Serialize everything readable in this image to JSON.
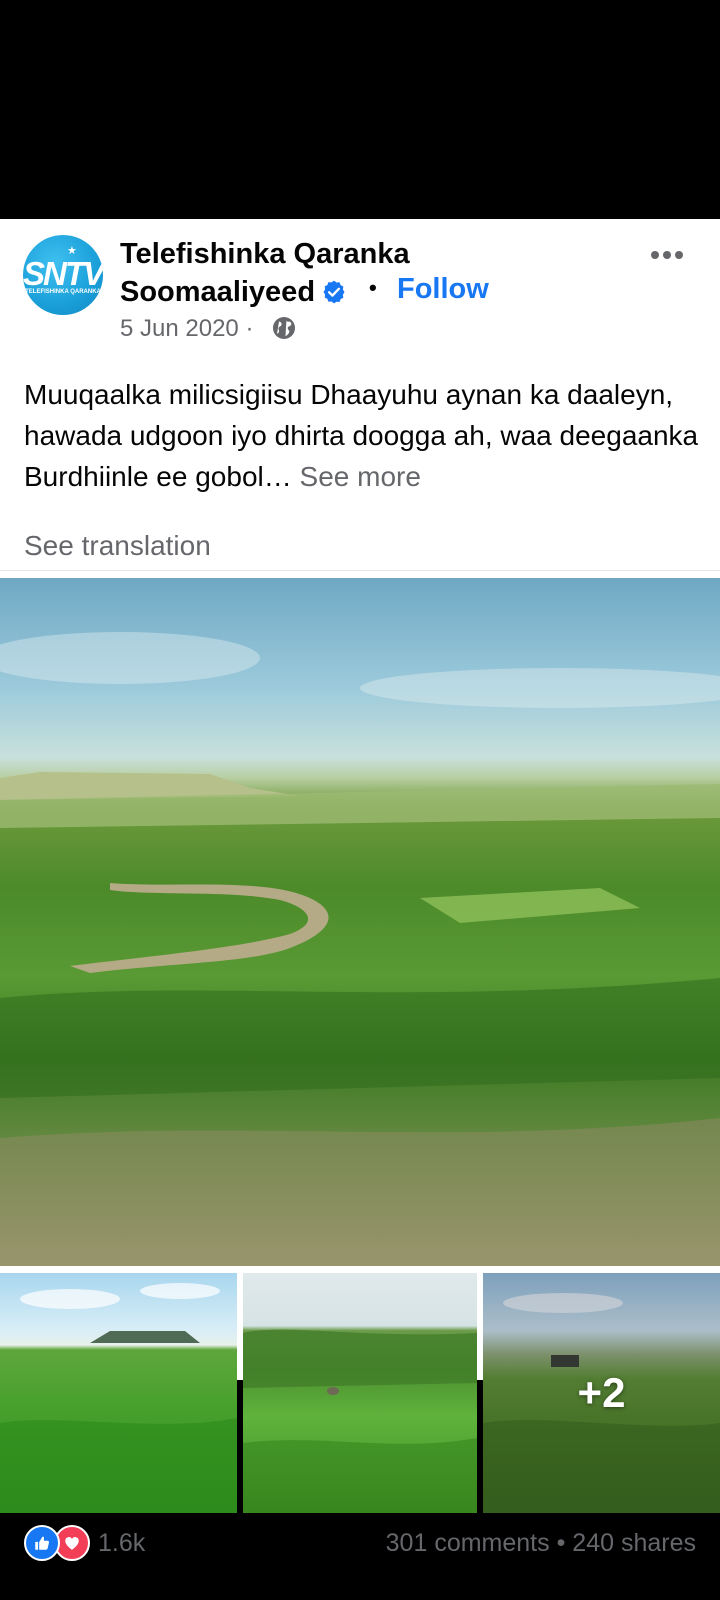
{
  "post": {
    "page_name_line1": "Telefishinka Qaranka",
    "page_name_line2": "Soomaaliyeed",
    "separator": "•",
    "follow_label": "Follow",
    "date": "5 Jun 2020 ·",
    "text": "Muuqaalka milicsigiisu Dhaayuhu aynan ka daaleyn, hawada udgoon iyo dhirta doogga ah, waa deegaanka Burdhiinle ee gobol…",
    "see_more_label": "See more",
    "see_translation_label": "See translation",
    "avatar_logo_text": "SNTV",
    "avatar_logo_subtext": "TELEFISHINKA QARANKA",
    "extra_photos_label": "+2"
  },
  "engagement": {
    "reaction_count": "1.6k",
    "comments": "301 comments",
    "stats_separator": "•",
    "shares": "240 shares"
  },
  "icons": {
    "verified": "verified-badge-icon",
    "audience": "globe-icon",
    "menu": "more-options-icon",
    "like": "like-reaction-icon",
    "love": "love-reaction-icon"
  },
  "colors": {
    "accent": "#1877f2",
    "secondary_text": "#65676b",
    "love": "#f33e58",
    "avatar": "#1a9fd9"
  }
}
